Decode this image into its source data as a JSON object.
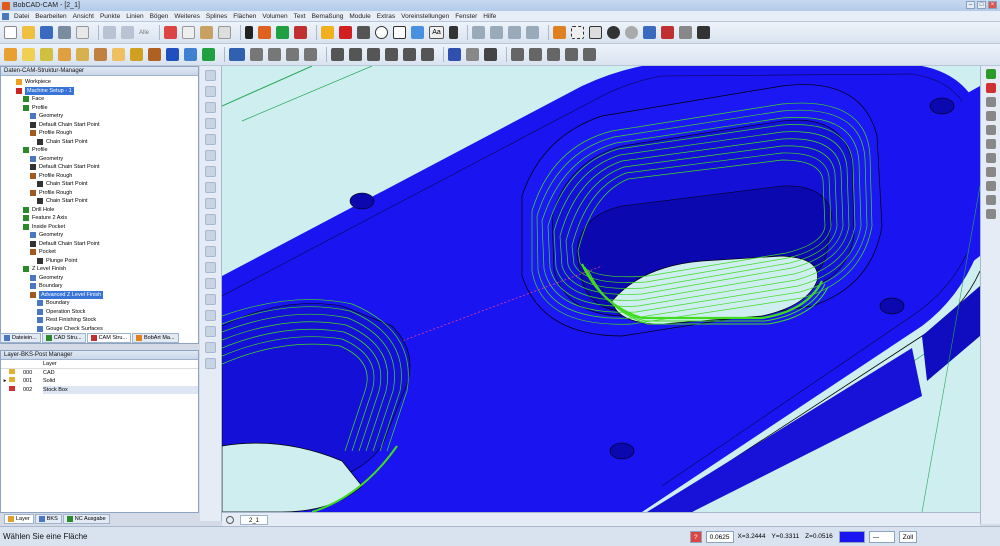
{
  "window": {
    "title": "BobCAD-CAM - [2_1]"
  },
  "menu": [
    "Datei",
    "Bearbeiten",
    "Ansicht",
    "Punkte",
    "Linien",
    "Bögen",
    "Weiteres",
    "Splines",
    "Flächen",
    "Volumen",
    "Text",
    "Bemaßung",
    "Module",
    "Extras",
    "Voreinstellungen",
    "Fenster",
    "Hilfe"
  ],
  "toolbar1": {
    "undo_label": "Alle"
  },
  "tree_panel": {
    "title": "Daten-CAM-Struktur-Manager",
    "nodes": [
      {
        "label": "Workpiece",
        "depth": 1,
        "icon": "workpiece-icon",
        "color": "#f0a020"
      },
      {
        "label": "Machine Setup - 1",
        "depth": 1,
        "icon": "machine-icon",
        "color": "#cc2222",
        "selected": true
      },
      {
        "label": "Face",
        "depth": 2,
        "icon": "face-icon",
        "color": "#2a8a2a"
      },
      {
        "label": "Profile",
        "depth": 2,
        "icon": "profile-icon",
        "color": "#2a8a2a"
      },
      {
        "label": "Geometry",
        "depth": 3,
        "icon": "geometry-icon",
        "color": "#4a78c0"
      },
      {
        "label": "Default Chain Start Point",
        "depth": 3,
        "icon": "point-icon",
        "color": "#333"
      },
      {
        "label": "Profile Rough",
        "depth": 3,
        "icon": "rough-icon",
        "color": "#a05a20"
      },
      {
        "label": "Chain Start Point",
        "depth": 4,
        "icon": "point-icon",
        "color": "#333"
      },
      {
        "label": "Profile",
        "depth": 2,
        "icon": "profile-icon",
        "color": "#2a8a2a"
      },
      {
        "label": "Geometry",
        "depth": 3,
        "icon": "geometry-icon",
        "color": "#4a78c0"
      },
      {
        "label": "Default Chain Start Point",
        "depth": 3,
        "icon": "point-icon",
        "color": "#333"
      },
      {
        "label": "Profile Rough",
        "depth": 3,
        "icon": "rough-icon",
        "color": "#a05a20"
      },
      {
        "label": "Chain Start Point",
        "depth": 4,
        "icon": "point-icon",
        "color": "#333"
      },
      {
        "label": "Profile Rough",
        "depth": 3,
        "icon": "rough-icon",
        "color": "#a05a20"
      },
      {
        "label": "Chain Start Point",
        "depth": 4,
        "icon": "point-icon",
        "color": "#333"
      },
      {
        "label": "Drill Hole",
        "depth": 2,
        "icon": "drill-icon",
        "color": "#2a8a2a"
      },
      {
        "label": "Feature 2 Axis",
        "depth": 2,
        "icon": "feature-icon",
        "color": "#2a8a2a"
      },
      {
        "label": "Inside Pocket",
        "depth": 2,
        "icon": "pocket-icon",
        "color": "#2a8a2a"
      },
      {
        "label": "Geometry",
        "depth": 3,
        "icon": "geometry-icon",
        "color": "#4a78c0"
      },
      {
        "label": "Default Chain Start Point",
        "depth": 3,
        "icon": "point-icon",
        "color": "#333"
      },
      {
        "label": "Pocket",
        "depth": 3,
        "icon": "pocket-icon",
        "color": "#a05a20"
      },
      {
        "label": "Plunge Point",
        "depth": 4,
        "icon": "point-icon",
        "color": "#333"
      },
      {
        "label": "Z Level Finish",
        "depth": 2,
        "icon": "zlevel-icon",
        "color": "#2a8a2a"
      },
      {
        "label": "Geometry",
        "depth": 3,
        "icon": "geometry-icon",
        "color": "#4a78c0"
      },
      {
        "label": "Boundary",
        "depth": 3,
        "icon": "boundary-icon",
        "color": "#4a78c0"
      },
      {
        "label": "Advanced Z Level Finish",
        "depth": 3,
        "icon": "advanced-icon",
        "color": "#a05a20",
        "selected": true
      },
      {
        "label": "Boundary",
        "depth": 4,
        "icon": "boundary-icon",
        "color": "#4a78c0"
      },
      {
        "label": "Operation Stock",
        "depth": 4,
        "icon": "stock-icon",
        "color": "#4a78c0"
      },
      {
        "label": "Rest Finishing Stock",
        "depth": 4,
        "icon": "stock-icon",
        "color": "#4a78c0"
      },
      {
        "label": "Gouge Check Surfaces",
        "depth": 4,
        "icon": "gouge-icon",
        "color": "#4a78c0"
      }
    ],
    "tabs": [
      "Dateiein...",
      "CAD Stru...",
      "CAM Stru...",
      "BobArt Ma..."
    ]
  },
  "layer_panel": {
    "title": "Layer-BKS-Post Manager",
    "header": "Layer",
    "rows": [
      {
        "num": "000",
        "name": "CAD",
        "checked": false
      },
      {
        "num": "001",
        "name": "Solid",
        "checked": true
      },
      {
        "num": "002",
        "name": "Stock Box",
        "checked": false
      }
    ],
    "tabs": [
      "Layer",
      "BKS",
      "NC Ausgabe"
    ]
  },
  "view_tab": "2_1",
  "status": {
    "message": "Wählen Sie eine Fläche",
    "snap_value": "0.0625",
    "x": "X=3.2444",
    "y": "Y=0.3311",
    "z": "Z=0.0516",
    "zoom_label": "Zoll"
  },
  "colors": {
    "solid_blue": "#1a14f0",
    "toolpath_green": "#3fdc1e",
    "background": "#cfeef0"
  }
}
